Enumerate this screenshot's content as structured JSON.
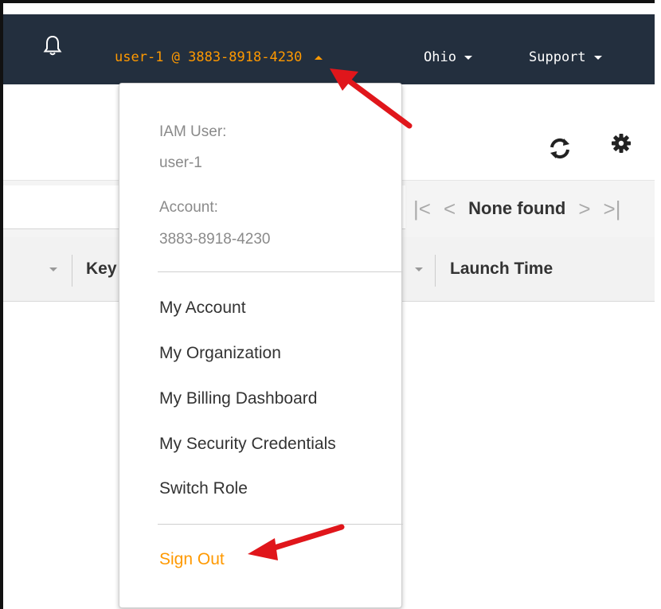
{
  "topbar": {
    "bell_icon": "bell-icon",
    "account_label": "user-1 @ 3883-8918-4230",
    "region_label": "Ohio",
    "support_label": "Support",
    "bg_color": "#232f3e",
    "accent_color": "#ff9900"
  },
  "toolbar": {
    "refresh_icon": "refresh-icon",
    "settings_icon": "gear-icon"
  },
  "pagination": {
    "status": "None found"
  },
  "table": {
    "columns": [
      "Key",
      "Launch Time"
    ]
  },
  "account_dropdown": {
    "iam_user_label": "IAM User:",
    "iam_user_value": "user-1",
    "account_label": "Account:",
    "account_value": "3883-8918-4230",
    "items": [
      "My Account",
      "My Organization",
      "My Billing Dashboard",
      "My Security Credentials",
      "Switch Role"
    ],
    "sign_out": "Sign Out"
  },
  "annotations": {
    "arrow_color": "#e0161b"
  }
}
